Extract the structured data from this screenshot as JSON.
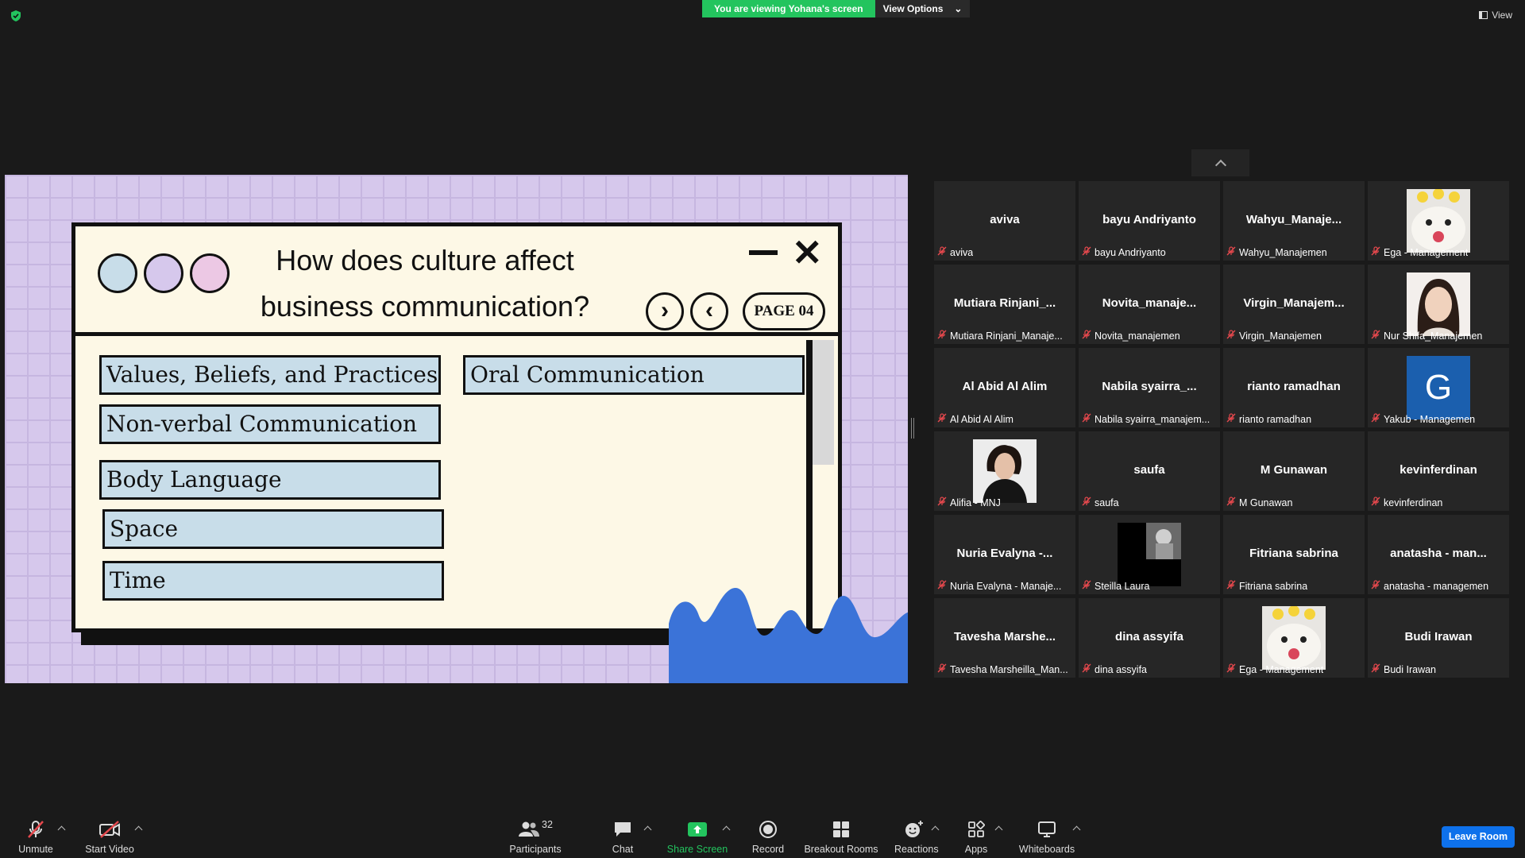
{
  "banner": {
    "viewing": "You are viewing Yohana's screen",
    "view_options": "View Options",
    "view": "View"
  },
  "slide": {
    "question_line1": "How does culture affect",
    "question_line2": "business communication?",
    "page_label": "PAGE 04",
    "topics_left": [
      "Values, Beliefs, and Practices",
      "Non-verbal Communication",
      "Body Language",
      "Space",
      "Time"
    ],
    "topic_right": "Oral Communication",
    "dot_colors": [
      "#c8dde9",
      "#d6c8ec",
      "#ecc8e4"
    ]
  },
  "participants": [
    {
      "big": "aviva",
      "label": "aviva"
    },
    {
      "big": "bayu Andriyanto",
      "label": "bayu Andriyanto"
    },
    {
      "big": "Wahyu_Manaje...",
      "label": "Wahyu_Manajemen"
    },
    {
      "big": "",
      "label": "Ega - Management",
      "avatar": "hamster"
    },
    {
      "big": "Mutiara  Rinjani_...",
      "label": "Mutiara Rinjani_Manaje..."
    },
    {
      "big": "Novita_manaje...",
      "label": "Novita_manajemen"
    },
    {
      "big": "Virgin_Manajem...",
      "label": "Virgin_Manajemen"
    },
    {
      "big": "",
      "label": "Nur Shifa_Manajemen",
      "avatar": "girl"
    },
    {
      "big": "Al Abid Al Alim",
      "label": "Al Abid Al Alim"
    },
    {
      "big": "Nabila  syairra_...",
      "label": "Nabila syairra_manajem..."
    },
    {
      "big": "rianto ramadhan",
      "label": "rianto ramadhan"
    },
    {
      "big": "",
      "label": "Yakub - Managemen",
      "avatar": "G"
    },
    {
      "big": "",
      "label": "Alifia - MNJ",
      "avatar": "woman"
    },
    {
      "big": "saufa",
      "label": "saufa"
    },
    {
      "big": "M Gunawan",
      "label": "M Gunawan"
    },
    {
      "big": "kevinferdinan",
      "label": "kevinferdinan"
    },
    {
      "big": "Nuria  Evalyna  -...",
      "label": "Nuria Evalyna - Manaje..."
    },
    {
      "big": "",
      "label": "Steilla Laura",
      "avatar": "bw"
    },
    {
      "big": "Fitriana sabrina",
      "label": "Fitriana sabrina"
    },
    {
      "big": "anatasha  -  man...",
      "label": "anatasha - managemen"
    },
    {
      "big": "Tavesha  Marshe...",
      "label": "Tavesha Marsheilla_Man..."
    },
    {
      "big": "dina assyifa",
      "label": "dina assyifa"
    },
    {
      "big": "",
      "label": "Ega - Management",
      "avatar": "hamster"
    },
    {
      "big": "Budi Irawan",
      "label": "Budi Irawan"
    }
  ],
  "toolbar": {
    "unmute": "Unmute",
    "start_video": "Start Video",
    "participants": "Participants",
    "participants_count": "32",
    "chat": "Chat",
    "share_screen": "Share Screen",
    "record": "Record",
    "breakout_rooms": "Breakout Rooms",
    "reactions": "Reactions",
    "apps": "Apps",
    "whiteboards": "Whiteboards",
    "leave_room": "Leave Room"
  },
  "colors": {
    "share_green": "#23c45e",
    "leave_blue": "#0e71eb",
    "muted_red": "#e5484d",
    "slide_purple": "#d6c8ec",
    "tag_blue": "#c8dde9",
    "wave_blue": "#3b73d8"
  }
}
